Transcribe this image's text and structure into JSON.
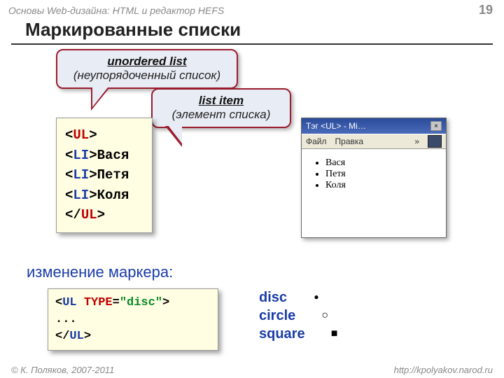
{
  "header": {
    "topic": "Основы Web-дизайна: HTML и редактор HEFS",
    "page": "19"
  },
  "title": "Маркированные списки",
  "callout_ul": {
    "en": "unordered list",
    "ru": "(неупорядоченный список)"
  },
  "callout_li": {
    "en": "list item",
    "ru": "(элемент списка)"
  },
  "code1": {
    "open": "<UL>",
    "li": "<LI>",
    "n1": "Вася",
    "n2": "Петя",
    "n3": "Коля",
    "close": "</UL>"
  },
  "browser": {
    "title": "Тэг <UL> - Mi…",
    "menu_file": "Файл",
    "menu_edit": "Правка",
    "chev": "»",
    "items": [
      "Вася",
      "Петя",
      "Коля"
    ]
  },
  "subheading": "изменение маркера:",
  "code2": {
    "open_a": "<UL ",
    "attr": "TYPE",
    "eq": "=",
    "val": "\"disc\"",
    "open_b": ">",
    "dots": "...",
    "close": "</UL>"
  },
  "markers": {
    "m1": "disc",
    "m2": "circle",
    "m3": "square"
  },
  "footer": {
    "copy": "© К. Поляков, 2007-2011",
    "url": "http://kpolyakov.narod.ru"
  }
}
